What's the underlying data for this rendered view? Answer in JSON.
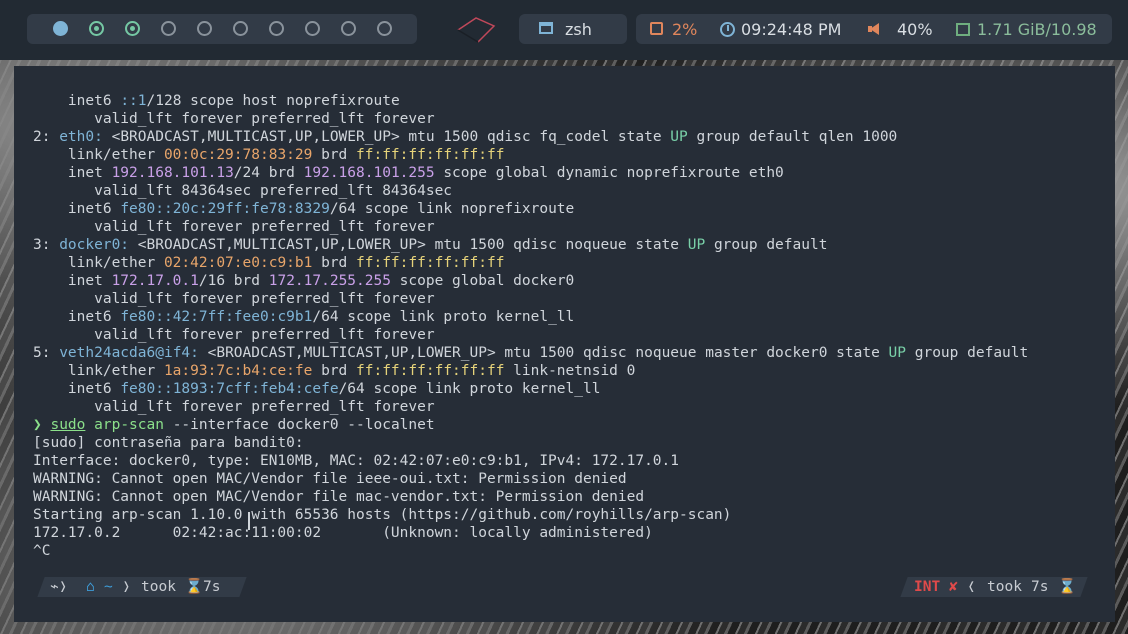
{
  "topbar": {
    "workspaces": [
      {
        "state": "active"
      },
      {
        "state": "occupied"
      },
      {
        "state": "occupied"
      },
      {
        "state": "empty"
      },
      {
        "state": "empty"
      },
      {
        "state": "empty"
      },
      {
        "state": "empty"
      },
      {
        "state": "empty"
      },
      {
        "state": "empty"
      },
      {
        "state": "empty"
      }
    ],
    "window_title": "zsh",
    "cpu": "2%",
    "clock": "09:24:48 PM",
    "volume": "40%",
    "memory": "1.71 GiB/10.98",
    "icons": [
      "cpu-icon",
      "clock-icon",
      "volume-icon",
      "memory-icon",
      "window-icon"
    ]
  },
  "terminal": {
    "lines": [
      [
        [
          "    inet6 ",
          ""
        ],
        [
          "::1",
          "c-v6"
        ],
        [
          "/128 scope host noprefixroute",
          ""
        ]
      ],
      [
        [
          "       valid_lft forever preferred_lft forever",
          ""
        ]
      ],
      [
        [
          "2: ",
          ""
        ],
        [
          "eth0:",
          "c-if"
        ],
        [
          " <BROADCAST,MULTICAST,UP,LOWER_UP> mtu 1500 qdisc fq_codel state ",
          ""
        ],
        [
          "UP",
          "c-up"
        ],
        [
          " group default qlen 1000",
          ""
        ]
      ],
      [
        [
          "    link/ether ",
          ""
        ],
        [
          "00:0c:29:78:83:29",
          "c-mac"
        ],
        [
          " brd ",
          ""
        ],
        [
          "ff:ff:ff:ff:ff:ff",
          "c-brd"
        ]
      ],
      [
        [
          "    inet ",
          ""
        ],
        [
          "192.168.101.13",
          "c-addr"
        ],
        [
          "/24 brd ",
          ""
        ],
        [
          "192.168.101.255",
          "c-addr"
        ],
        [
          " scope global dynamic noprefixroute eth0",
          ""
        ]
      ],
      [
        [
          "       valid_lft 84364sec preferred_lft 84364sec",
          ""
        ]
      ],
      [
        [
          "    inet6 ",
          ""
        ],
        [
          "fe80::20c:29ff:fe78:8329",
          "c-v6"
        ],
        [
          "/64 scope link noprefixroute",
          ""
        ]
      ],
      [
        [
          "       valid_lft forever preferred_lft forever",
          ""
        ]
      ],
      [
        [
          "3: ",
          ""
        ],
        [
          "docker0:",
          "c-if"
        ],
        [
          " <BROADCAST,MULTICAST,UP,LOWER_UP> mtu 1500 qdisc noqueue state ",
          ""
        ],
        [
          "UP",
          "c-up"
        ],
        [
          " group default",
          ""
        ]
      ],
      [
        [
          "    link/ether ",
          ""
        ],
        [
          "02:42:07:e0:c9:b1",
          "c-mac"
        ],
        [
          " brd ",
          ""
        ],
        [
          "ff:ff:ff:ff:ff:ff",
          "c-brd"
        ]
      ],
      [
        [
          "    inet ",
          ""
        ],
        [
          "172.17.0.1",
          "c-addr"
        ],
        [
          "/16 brd ",
          ""
        ],
        [
          "172.17.255.255",
          "c-addr"
        ],
        [
          " scope global docker0",
          ""
        ]
      ],
      [
        [
          "       valid_lft forever preferred_lft forever",
          ""
        ]
      ],
      [
        [
          "    inet6 ",
          ""
        ],
        [
          "fe80::42:7ff:fee0:c9b1",
          "c-v6"
        ],
        [
          "/64 scope link proto kernel_ll",
          ""
        ]
      ],
      [
        [
          "       valid_lft forever preferred_lft forever",
          ""
        ]
      ],
      [
        [
          "5: ",
          ""
        ],
        [
          "veth24acda6@if4:",
          "c-if"
        ],
        [
          " <BROADCAST,MULTICAST,UP,LOWER_UP> mtu 1500 qdisc noqueue master docker0 state ",
          ""
        ],
        [
          "UP",
          "c-up"
        ],
        [
          " group default",
          ""
        ]
      ],
      [
        [
          "    link/ether ",
          ""
        ],
        [
          "1a:93:7c:b4:ce:fe",
          "c-mac"
        ],
        [
          " brd ",
          ""
        ],
        [
          "ff:ff:ff:ff:ff:ff",
          "c-brd"
        ],
        [
          " link-netnsid 0",
          ""
        ]
      ],
      [
        [
          "    inet6 ",
          ""
        ],
        [
          "fe80::1893:7cff:feb4:cefe",
          "c-v6"
        ],
        [
          "/64 scope link proto kernel_ll",
          ""
        ]
      ],
      [
        [
          "       valid_lft forever preferred_lft forever",
          ""
        ]
      ],
      [
        [
          "❯ ",
          "c-arrow"
        ],
        [
          "sudo",
          "c-sudo"
        ],
        [
          " ",
          ""
        ],
        [
          "arp-scan",
          "c-cmd"
        ],
        [
          " --interface docker0 --localnet",
          ""
        ]
      ],
      [
        [
          "[sudo] contraseña para bandit0:",
          ""
        ]
      ],
      [
        [
          "Interface: docker0, type: EN10MB, MAC: 02:42:07:e0:c9:b1, IPv4: 172.17.0.1",
          ""
        ]
      ],
      [
        [
          "WARNING: Cannot open MAC/Vendor file ieee-oui.txt: Permission denied",
          ""
        ]
      ],
      [
        [
          "WARNING: Cannot open MAC/Vendor file mac-vendor.txt: Permission denied",
          ""
        ]
      ],
      [
        [
          "Starting arp-scan 1.10.0 with 65536 hosts (https://github.com/royhills/arp-scan)",
          ""
        ]
      ],
      [
        [
          "172.17.0.2      02:42:ac:11:00:02       (Unknown: locally administered)",
          ""
        ]
      ],
      [
        [
          "^C",
          ""
        ]
      ]
    ],
    "prompt": {
      "dir": "~",
      "took_label": "took",
      "took_time": "7s",
      "status": "INT",
      "status_icon": "✘",
      "right_took_label": "took",
      "right_took_time": "7s"
    }
  }
}
